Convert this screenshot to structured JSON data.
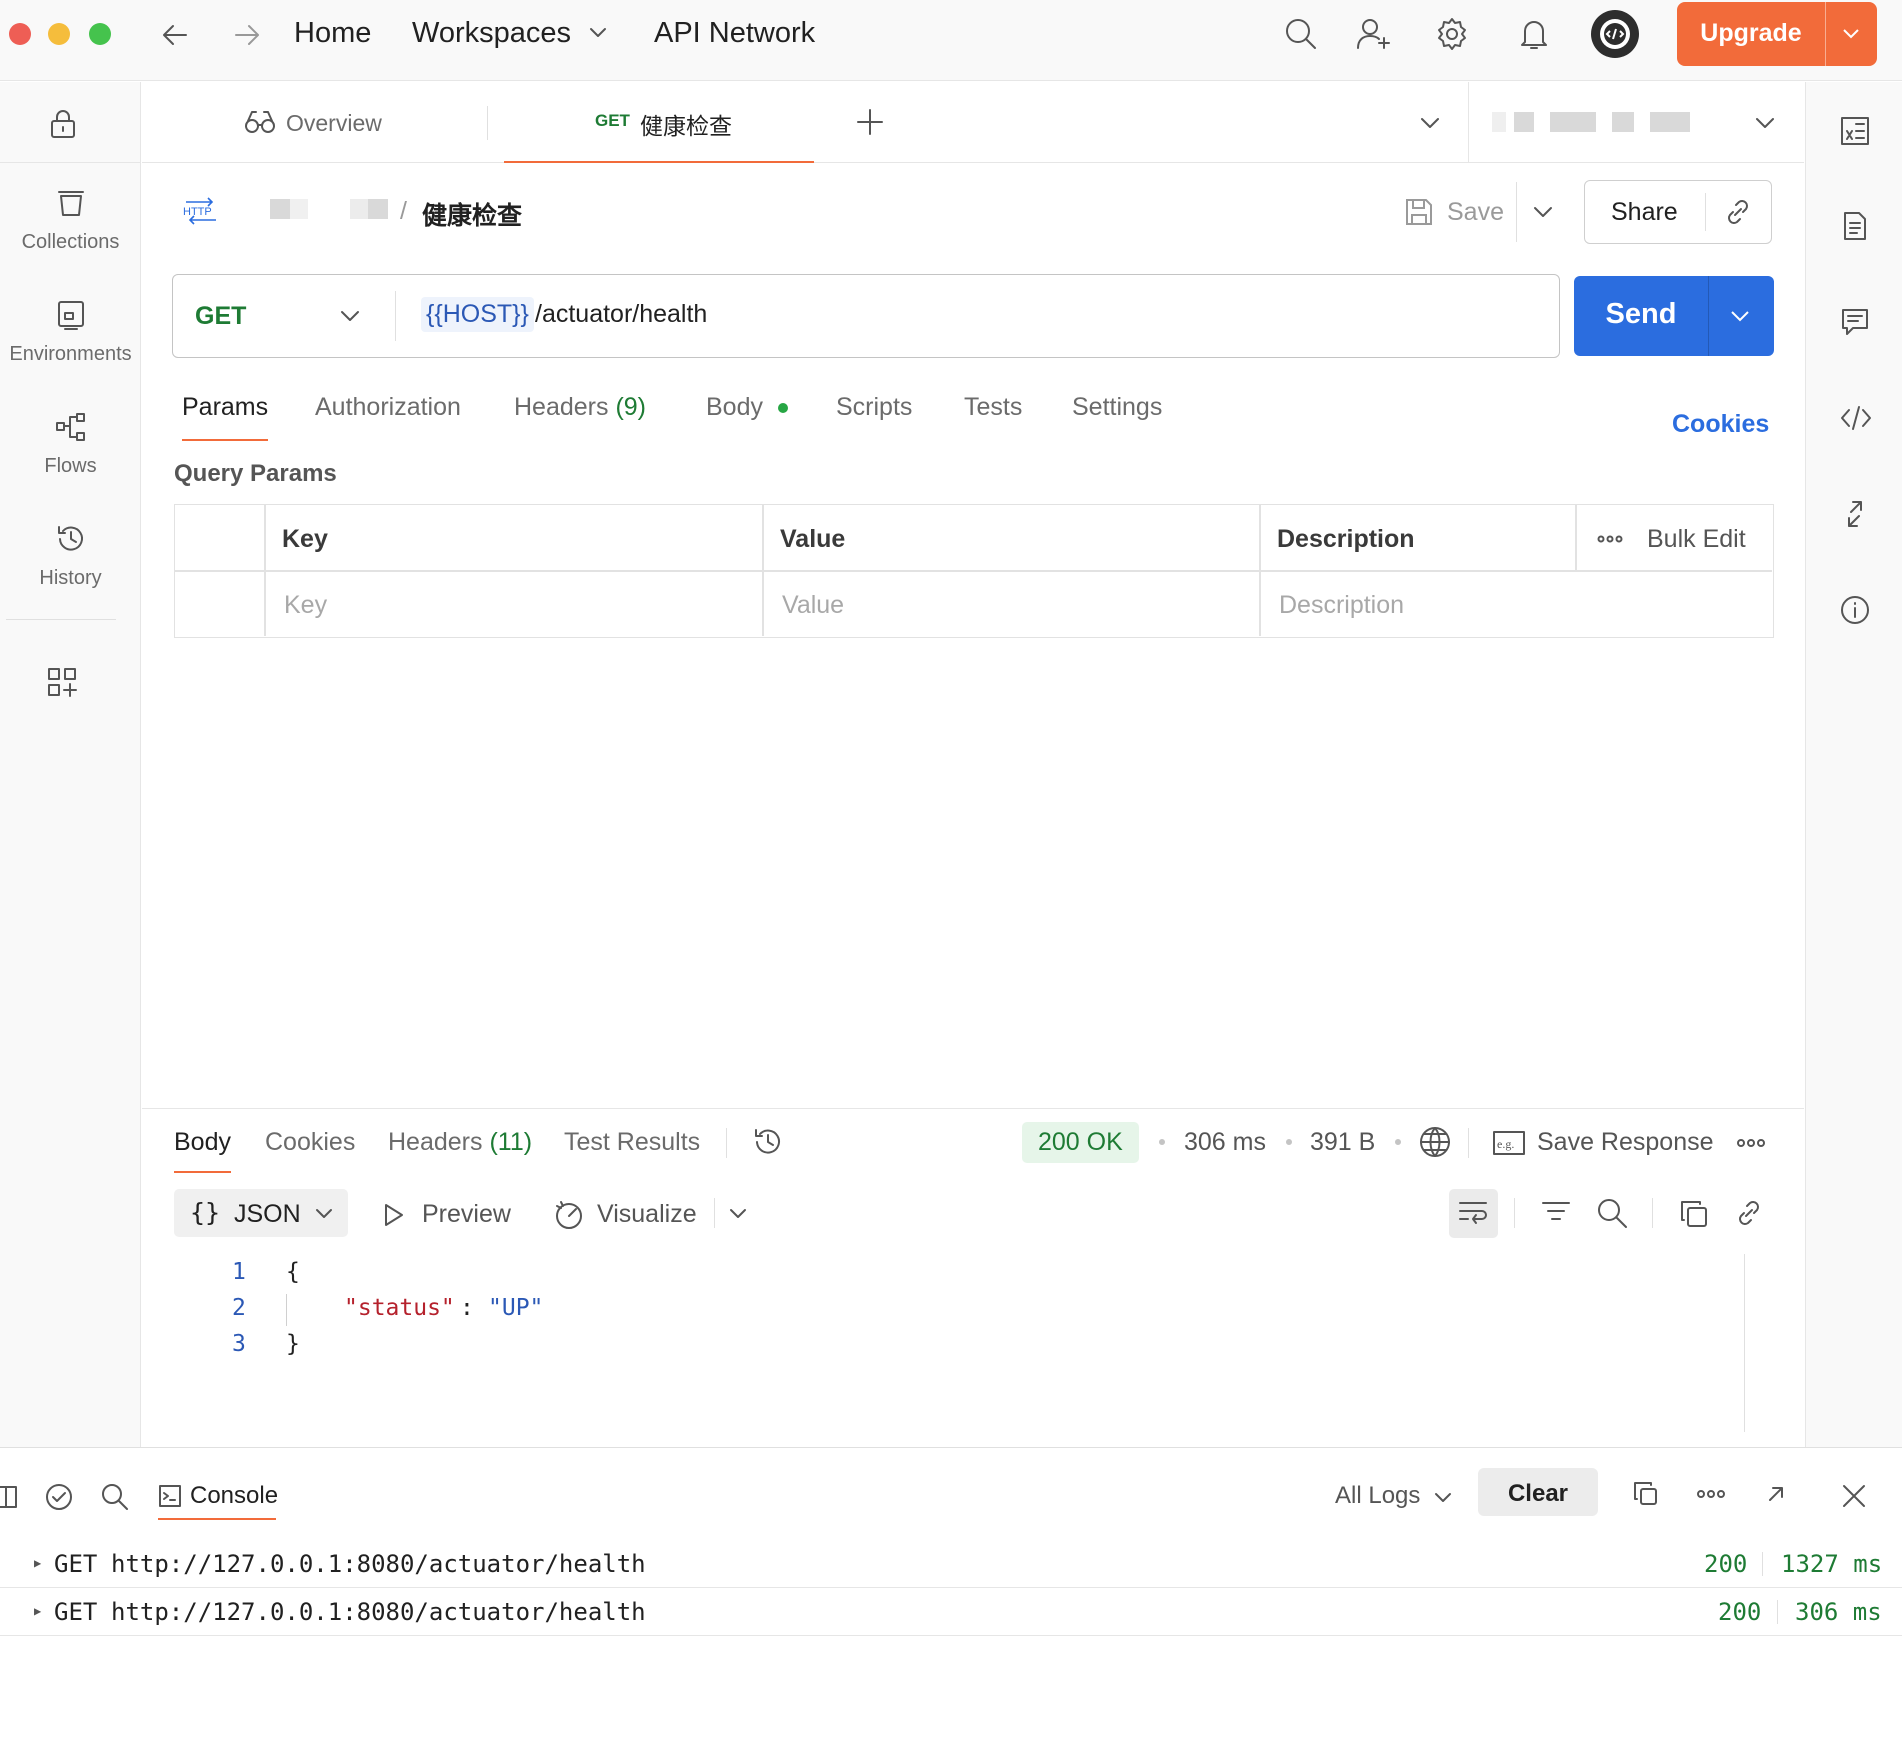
{
  "topbar": {
    "home": "Home",
    "workspaces": "Workspaces",
    "api_network": "API Network",
    "upgrade": "Upgrade"
  },
  "sidebar": {
    "items": [
      {
        "label": "Collections",
        "icon": "collections-icon"
      },
      {
        "label": "Environments",
        "icon": "environments-icon"
      },
      {
        "label": "Flows",
        "icon": "flows-icon"
      },
      {
        "label": "History",
        "icon": "history-icon"
      }
    ]
  },
  "tabs": {
    "overview": "Overview",
    "active_method": "GET",
    "active_name": "健康检查"
  },
  "request": {
    "breadcrumb_sep": "/",
    "breadcrumb_name": "健康检查",
    "save": "Save",
    "share": "Share",
    "method": "GET",
    "url_variable": "{{HOST}}",
    "url_path": "/actuator/health",
    "send": "Send",
    "tabs": {
      "params": "Params",
      "authorization": "Authorization",
      "headers": "Headers",
      "headers_count": "(9)",
      "body": "Body",
      "scripts": "Scripts",
      "tests": "Tests",
      "settings": "Settings"
    },
    "cookies": "Cookies",
    "query_params_title": "Query Params",
    "table": {
      "col_key": "Key",
      "col_value": "Value",
      "col_description": "Description",
      "bulk_edit": "Bulk Edit",
      "ph_key": "Key",
      "ph_value": "Value",
      "ph_description": "Description"
    }
  },
  "response": {
    "tabs": {
      "body": "Body",
      "cookies": "Cookies",
      "headers": "Headers",
      "headers_count": "(11)",
      "test_results": "Test Results"
    },
    "status": "200 OK",
    "time": "306 ms",
    "size": "391 B",
    "save_response": "Save Response",
    "format": "JSON",
    "preview": "Preview",
    "visualize": "Visualize",
    "lines": [
      {
        "num": "1",
        "text": "{"
      },
      {
        "num": "2",
        "key": "\"status\"",
        "colon": ":",
        "value": "\"UP\""
      },
      {
        "num": "3",
        "text": "}"
      }
    ]
  },
  "console": {
    "title": "Console",
    "all_logs": "All Logs",
    "clear": "Clear",
    "logs": [
      {
        "method": "GET",
        "url": "http://127.0.0.1:8080/actuator/health",
        "status": "200",
        "time": "1327 ms"
      },
      {
        "method": "GET",
        "url": "http://127.0.0.1:8080/actuator/health",
        "status": "200",
        "time": "306 ms"
      }
    ]
  },
  "colors": {
    "accent_orange": "#f26b3a",
    "send_blue": "#2b6ddf",
    "get_green": "#1e7b34",
    "status_green_bg": "#e6f5e9"
  }
}
